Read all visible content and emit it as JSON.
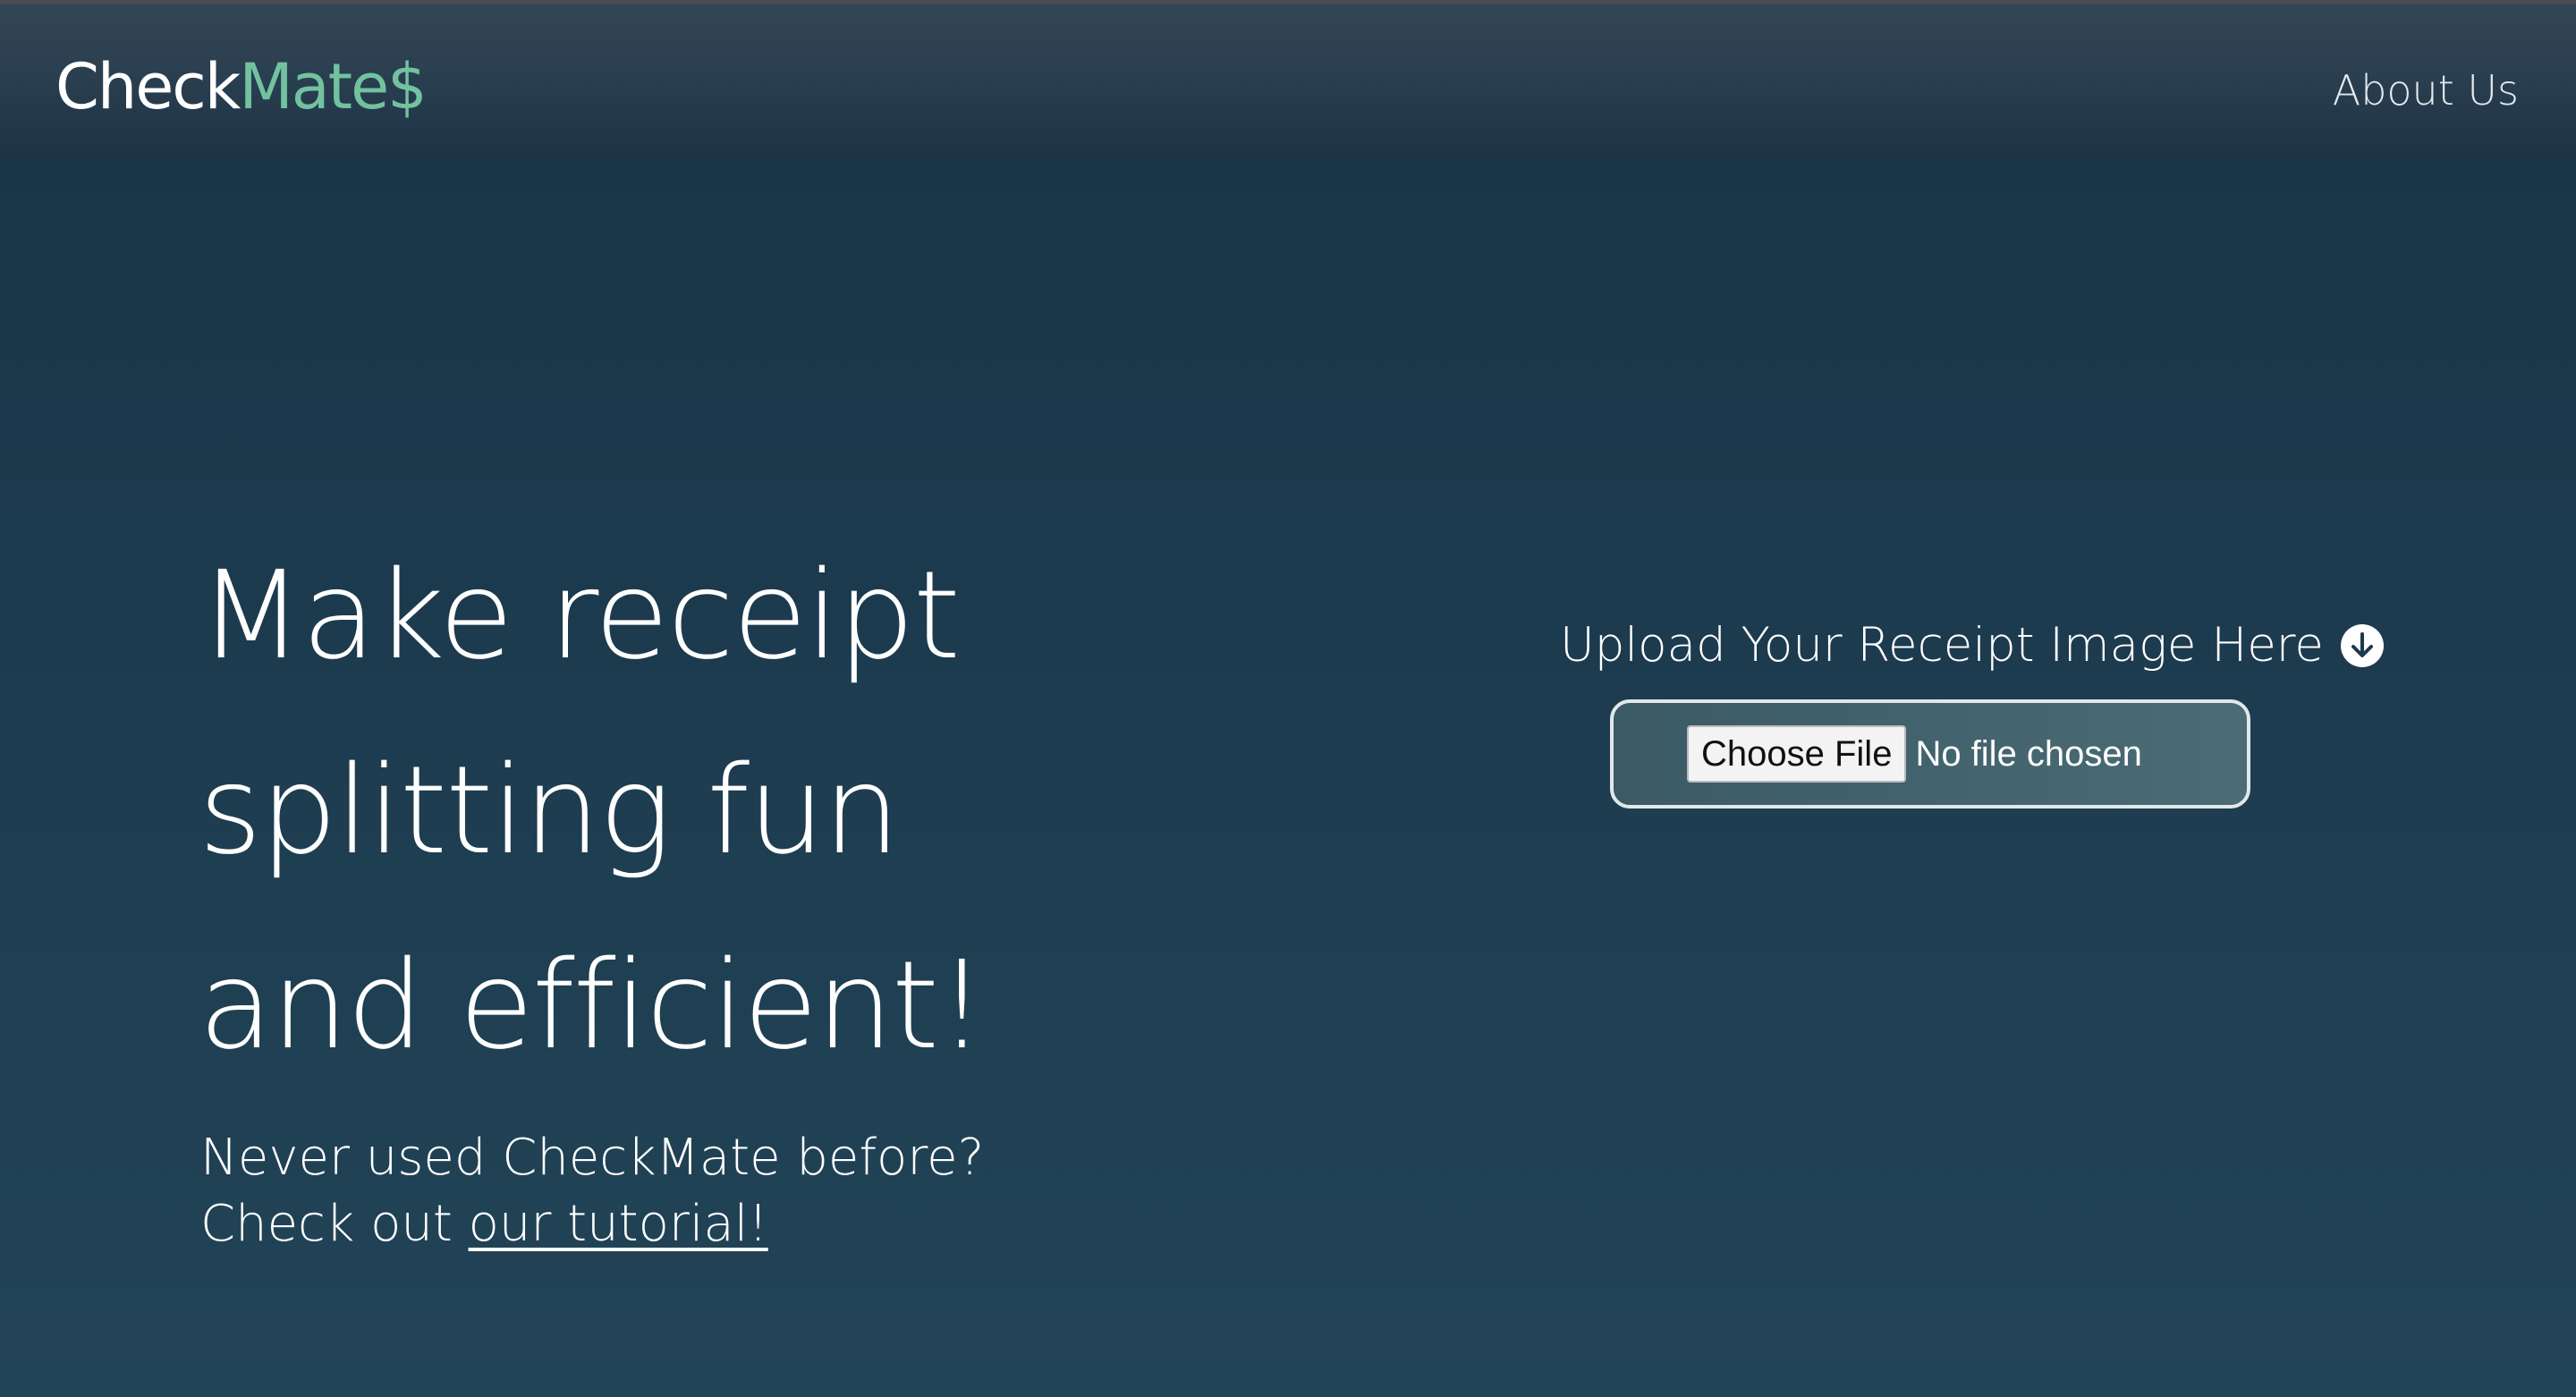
{
  "nav": {
    "logo_part1": "Check",
    "logo_part2": "Mate$",
    "about_label": "About Us"
  },
  "hero": {
    "title_lines": [
      "Make receipt",
      "splitting fun",
      "and efficient!"
    ],
    "tutorial_prefix": "Never used CheckMate before?",
    "tutorial_check": "Check out ",
    "tutorial_link": "our tutorial!"
  },
  "upload": {
    "label": "Upload Your Receipt Image Here",
    "icon": "arrow-down-circle-icon",
    "choose_button": "Choose File",
    "file_status": "No file chosen"
  },
  "colors": {
    "brand_accent": "#72c2a0",
    "background_dark": "#1a3345",
    "background_light": "#224457"
  }
}
